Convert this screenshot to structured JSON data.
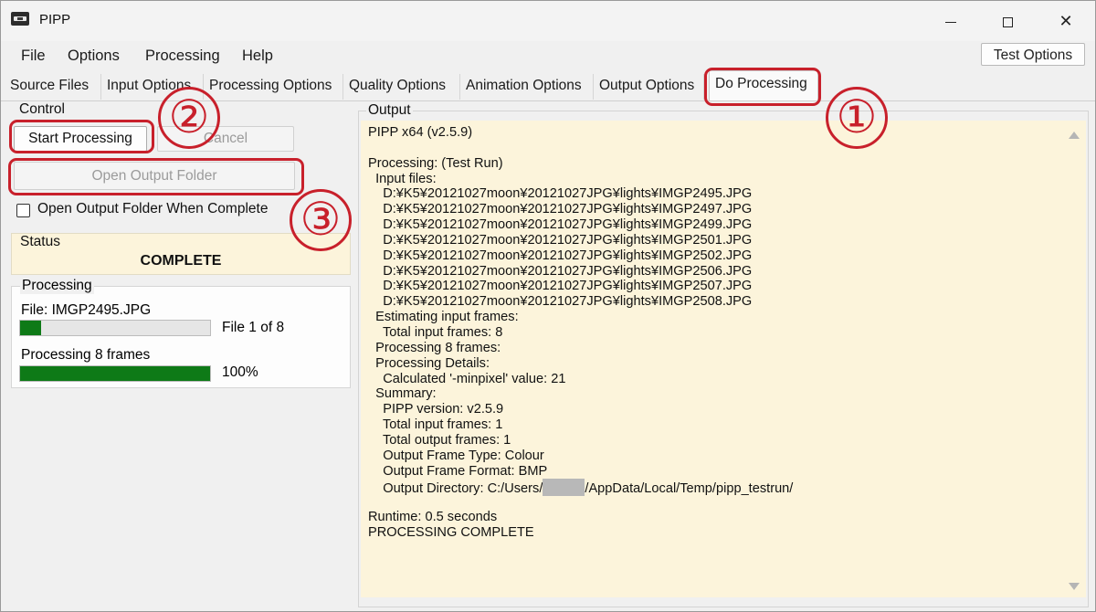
{
  "window": {
    "title": "PIPP"
  },
  "menu": [
    "File",
    "Options",
    "Processing",
    "Help"
  ],
  "test_options_button": "Test Options",
  "tabs": [
    "Source Files",
    "Input Options",
    "Processing Options",
    "Quality Options",
    "Animation Options",
    "Output Options",
    "Do Processing"
  ],
  "active_tab": "Do Processing",
  "control": {
    "label": "Control",
    "start_button": "Start Processing",
    "cancel_button": "Cancel",
    "open_folder_button": "Open Output Folder",
    "checkbox_label": "Open Output Folder When Complete",
    "checkbox_checked": false
  },
  "status": {
    "label": "Status",
    "value": "COMPLETE"
  },
  "processing": {
    "label": "Processing",
    "file_label": "File: IMGP2495.JPG",
    "file_progress_text": "File 1 of 8",
    "file_progress_fraction": 0.11,
    "frames_label": "Processing 8 frames",
    "frames_progress_text": "100%",
    "frames_progress_fraction": 1.0
  },
  "output": {
    "label": "Output",
    "lines": [
      "PIPP x64 (v2.5.9)",
      "",
      "Processing: (Test Run)",
      "  Input files:",
      "    D:¥K5¥20121027moon¥20121027JPG¥lights¥IMGP2495.JPG",
      "    D:¥K5¥20121027moon¥20121027JPG¥lights¥IMGP2497.JPG",
      "    D:¥K5¥20121027moon¥20121027JPG¥lights¥IMGP2499.JPG",
      "    D:¥K5¥20121027moon¥20121027JPG¥lights¥IMGP2501.JPG",
      "    D:¥K5¥20121027moon¥20121027JPG¥lights¥IMGP2502.JPG",
      "    D:¥K5¥20121027moon¥20121027JPG¥lights¥IMGP2506.JPG",
      "    D:¥K5¥20121027moon¥20121027JPG¥lights¥IMGP2507.JPG",
      "    D:¥K5¥20121027moon¥20121027JPG¥lights¥IMGP2508.JPG",
      "  Estimating input frames:",
      "    Total input frames: 8",
      "  Processing 8 frames:",
      "  Processing Details:",
      "    Calculated '-minpixel' value: 21",
      "  Summary:",
      "    PIPP version: v2.5.9",
      "    Total input frames: 1",
      "    Total output frames: 1",
      "    Output Frame Type: Colour",
      "    Output Frame Format: BMP"
    ],
    "dir_prefix": "    Output Directory: C:/Users/",
    "dir_suffix": "/AppData/Local/Temp/pipp_testrun/",
    "tail_lines": [
      "",
      "Runtime: 0.5 seconds",
      "PROCESSING COMPLETE"
    ]
  },
  "annotations": [
    "①",
    "②",
    "③"
  ],
  "colors": {
    "accent_red": "#c8202b",
    "progress_green": "#0e7a17",
    "panel_bg": "#fcf4db"
  }
}
